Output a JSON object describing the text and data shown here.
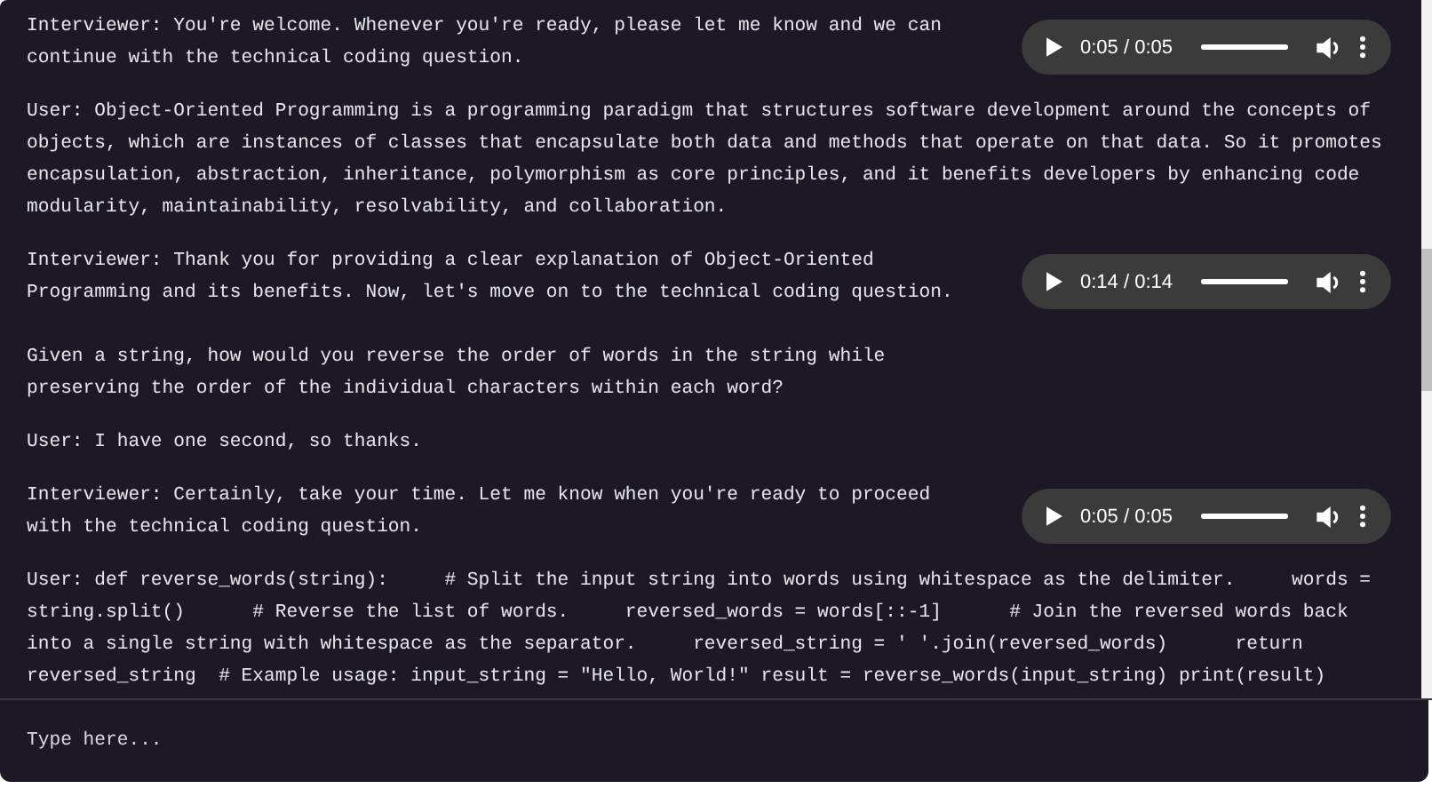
{
  "messages": [
    {
      "text": "Interviewer: You're welcome. Whenever you're ready, please let me know and we can\ncontinue with the technical coding question.",
      "audio": {
        "time": "0:05 / 0:05",
        "level": 1
      }
    },
    {
      "text": "User: Object-Oriented Programming is a programming paradigm that structures software development around the concepts of\nobjects, which are instances of classes that encapsulate both data and methods that operate on that data. So it promotes\nencapsulation, abstraction, inheritance, polymorphism as core principles, and it benefits developers by enhancing code\nmodularity, maintainability, resolvability, and collaboration."
    },
    {
      "text": "Interviewer: Thank you for providing a clear explanation of Object-Oriented\nProgramming and its benefits. Now, let's move on to the technical coding question.\n\nGiven a string, how would you reverse the order of words in the string while\npreserving the order of the individual characters within each word?",
      "audio": {
        "time": "0:14 / 0:14",
        "level": 1
      }
    },
    {
      "text": "User: I have one second, so thanks."
    },
    {
      "text": "Interviewer: Certainly, take your time. Let me know when you're ready to proceed\nwith the technical coding question.",
      "audio": {
        "time": "0:05 / 0:05",
        "level": 1
      }
    },
    {
      "text": "User: def reverse_words(string):     # Split the input string into words using whitespace as the delimiter.     words =\nstring.split()      # Reverse the list of words.     reversed_words = words[::-1]      # Join the reversed words back\ninto a single string with whitespace as the separator.     reversed_string = ' '.join(reversed_words)      return\nreversed_string  # Example usage: input_string = \"Hello, World!\" result = reverse_words(input_string) print(result)"
    }
  ],
  "input": {
    "placeholder": "Type here..."
  }
}
